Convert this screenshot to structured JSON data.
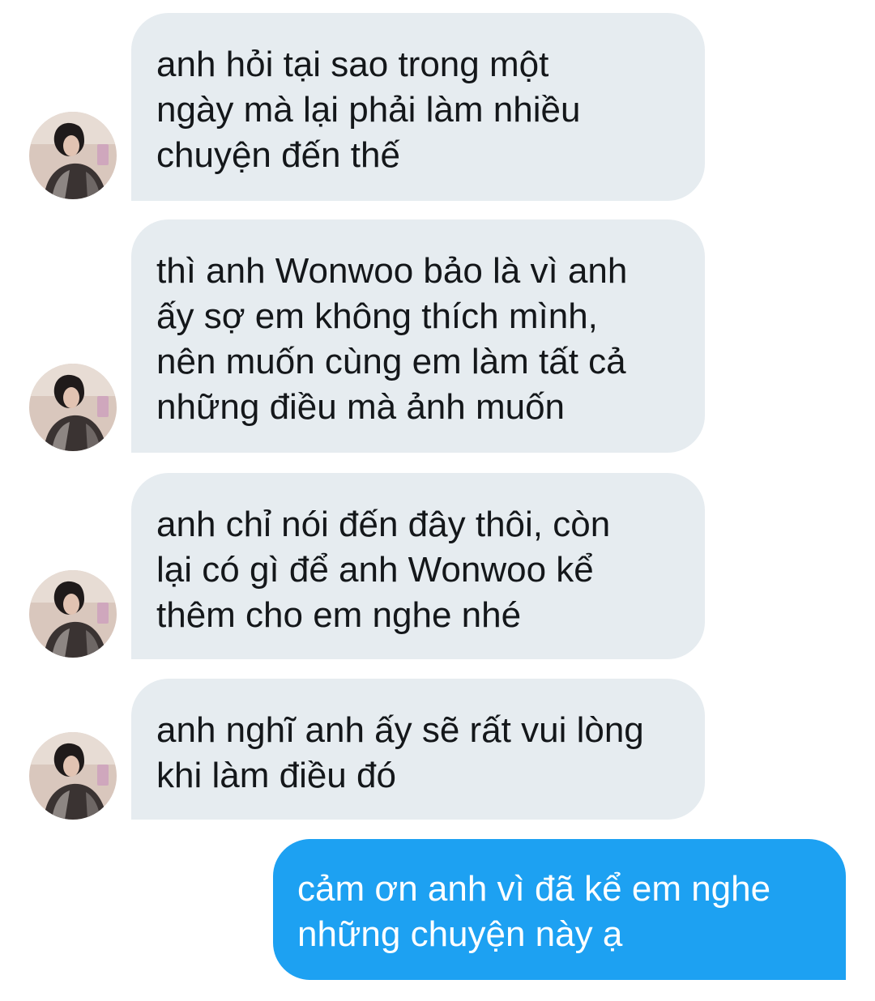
{
  "conversation": {
    "messages": [
      {
        "direction": "incoming",
        "lines": [
          "anh hỏi tại sao trong một",
          "ngày mà lại phải làm nhiều",
          "chuyện đến thế"
        ],
        "avatar_icon": "user-avatar-photo"
      },
      {
        "direction": "incoming",
        "lines": [
          "thì anh Wonwoo bảo là vì anh",
          "ấy sợ em không thích mình,",
          "nên muốn cùng em làm tất cả",
          "những điều mà ảnh muốn"
        ],
        "avatar_icon": "user-avatar-photo"
      },
      {
        "direction": "incoming",
        "lines": [
          "anh chỉ nói đến đây thôi, còn",
          "lại có gì để anh Wonwoo kể",
          "thêm cho em nghe nhé"
        ],
        "avatar_icon": "user-avatar-photo"
      },
      {
        "direction": "incoming",
        "lines": [
          "anh nghĩ anh ấy sẽ rất vui lòng",
          "khi làm điều đó"
        ],
        "avatar_icon": "user-avatar-photo"
      },
      {
        "direction": "outgoing",
        "lines": [
          "cảm ơn anh vì đã kể em nghe",
          "những chuyện này ạ"
        ]
      }
    ]
  },
  "colors": {
    "incoming_bubble": "#e6ecf0",
    "incoming_text": "#14171a",
    "outgoing_bubble": "#1da1f2",
    "outgoing_text": "#ffffff",
    "background": "#ffffff"
  }
}
